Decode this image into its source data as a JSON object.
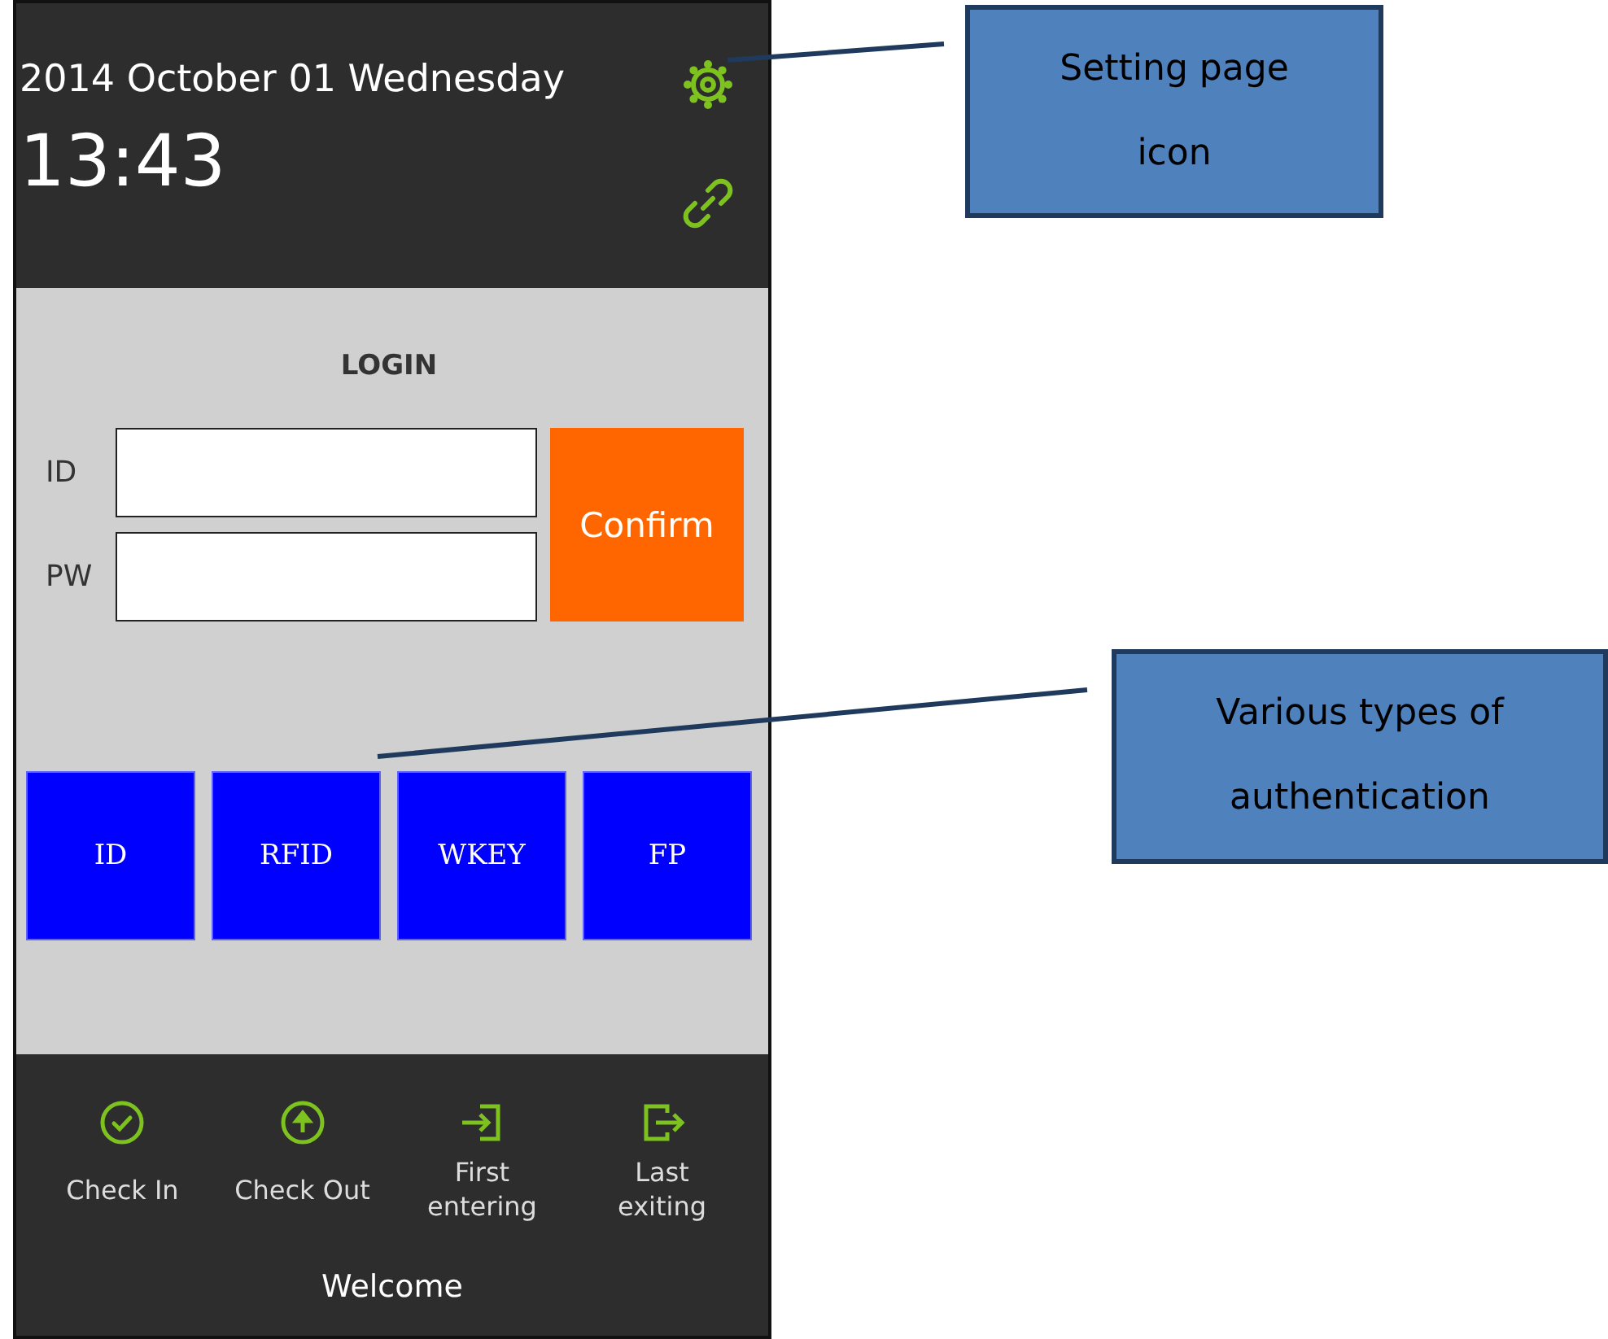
{
  "header": {
    "date": "2014 October 01 Wednesday",
    "time": "13:43"
  },
  "login": {
    "title": "LOGIN",
    "fields": [
      {
        "label": "ID"
      },
      {
        "label": "PW"
      }
    ],
    "confirm": "Confirm"
  },
  "auth_buttons": [
    "ID",
    "RFID",
    "WKEY",
    "FP"
  ],
  "actions": [
    {
      "lines": [
        "Check In"
      ],
      "kind": "check"
    },
    {
      "lines": [
        "Check Out"
      ],
      "kind": "up"
    },
    {
      "lines": [
        "First",
        "entering"
      ],
      "kind": "enter"
    },
    {
      "lines": [
        "Last",
        "exiting"
      ],
      "kind": "exit"
    }
  ],
  "welcome": "Welcome",
  "callouts": [
    {
      "lines": [
        "Setting page",
        "icon"
      ]
    },
    {
      "lines": [
        "Various types of",
        "authentication"
      ]
    }
  ]
}
